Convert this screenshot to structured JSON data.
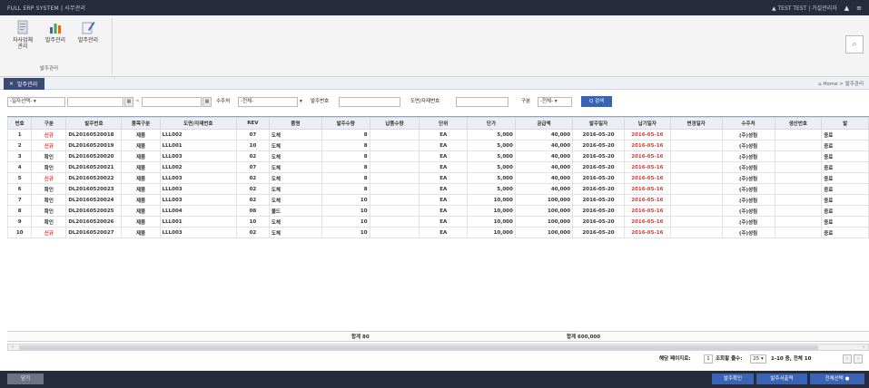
{
  "topbar": {
    "app_title": "FULL ERP SYSTEM  |  사무관리",
    "user": "▲ TEST TEST | 가설관리자",
    "home_icon": "▲",
    "menu_icon": "≡"
  },
  "ribbon": {
    "buttons": [
      {
        "label": "자사업체\n관리",
        "icon": "document-icon"
      },
      {
        "label": "발주관리",
        "icon": "chart-icon"
      },
      {
        "label": "발주관리",
        "icon": "edit-icon"
      }
    ],
    "group_label": "발주관리"
  },
  "section": {
    "tab_label": "발주관리",
    "breadcrumb": "⌂ Home  >  발주관리"
  },
  "filters": {
    "date_type": "-일자선택- ▾",
    "customer_label": "수주처",
    "customer_value": "-전체-",
    "order_no_label": "발주번호",
    "drawing_label": "도면/자재번호",
    "type_label": "구분",
    "type_value": "-전체- ▾",
    "search_button": "Q 검색"
  },
  "table": {
    "headers": [
      "번호",
      "구분",
      "발주번호",
      "품목구분",
      "도면/자재번호",
      "REV",
      "품명",
      "발주수량",
      "납품수량",
      "단위",
      "단가",
      "공급액",
      "발주일자",
      "납기일자",
      "변경일자",
      "수주처",
      "생산번호",
      "발"
    ],
    "rows": [
      [
        "1",
        "신규",
        "DL20160520018",
        "제품",
        "LLL002",
        "07",
        "도체",
        "8",
        "",
        "EA",
        "5,000",
        "40,000",
        "2016-05-20",
        "2016-05-16",
        "",
        "(주)성림",
        "",
        "종료"
      ],
      [
        "2",
        "신규",
        "DL20160520019",
        "제품",
        "LLL001",
        "10",
        "도체",
        "8",
        "",
        "EA",
        "5,000",
        "40,000",
        "2016-05-20",
        "2016-05-16",
        "",
        "(주)성림",
        "",
        "종료"
      ],
      [
        "3",
        "확인",
        "DL20160520020",
        "제품",
        "LLL003",
        "02",
        "도체",
        "8",
        "",
        "EA",
        "5,000",
        "40,000",
        "2016-05-20",
        "2016-05-16",
        "",
        "(주)성림",
        "",
        "종료"
      ],
      [
        "4",
        "확인",
        "DL20160520021",
        "제품",
        "LLL002",
        "07",
        "도체",
        "8",
        "",
        "EA",
        "5,000",
        "40,000",
        "2016-05-20",
        "2016-05-16",
        "",
        "(주)성림",
        "",
        "종료"
      ],
      [
        "5",
        "신규",
        "DL20160520022",
        "제품",
        "LLL003",
        "02",
        "도체",
        "8",
        "",
        "EA",
        "5,000",
        "40,000",
        "2016-05-20",
        "2016-05-16",
        "",
        "(주)성림",
        "",
        "종료"
      ],
      [
        "6",
        "확인",
        "DL20160520023",
        "제품",
        "LLL003",
        "02",
        "도체",
        "8",
        "",
        "EA",
        "5,000",
        "40,000",
        "2016-05-20",
        "2016-05-16",
        "",
        "(주)성림",
        "",
        "종료"
      ],
      [
        "7",
        "확인",
        "DL20160520024",
        "제품",
        "LLL003",
        "02",
        "도체",
        "10",
        "",
        "EA",
        "10,000",
        "100,000",
        "2016-05-20",
        "2016-05-16",
        "",
        "(주)성림",
        "",
        "종료"
      ],
      [
        "8",
        "확인",
        "DL20160520025",
        "제품",
        "LLL004",
        "08",
        "몰드",
        "10",
        "",
        "EA",
        "10,000",
        "100,000",
        "2016-05-20",
        "2016-05-16",
        "",
        "(주)성림",
        "",
        "종료"
      ],
      [
        "9",
        "확인",
        "DL20160520026",
        "제품",
        "LLL001",
        "10",
        "도체",
        "10",
        "",
        "EA",
        "10,000",
        "100,000",
        "2016-05-20",
        "2016-05-16",
        "",
        "(주)성림",
        "",
        "종료"
      ],
      [
        "10",
        "신규",
        "DL20160520027",
        "제품",
        "LLL003",
        "02",
        "도체",
        "10",
        "",
        "EA",
        "10,000",
        "100,000",
        "2016-05-20",
        "2016-05-16",
        "",
        "(주)성림",
        "",
        "종료"
      ]
    ]
  },
  "summary": {
    "qty_total": "합계 80",
    "amount_total": "합계 600,000"
  },
  "pager": {
    "page_label": "해당 페이지로:",
    "page_value": "1",
    "rows_label": "조회할 줄수:",
    "rows_value": "25 ▾",
    "range_text": "1-10 중, 전체 10",
    "prev": "‹",
    "next": "›"
  },
  "bottom": {
    "close_button": "닫기",
    "btn_confirm": "발주확인",
    "btn_print": "발주서출력",
    "btn_select_all": "전체선택 ●"
  },
  "colors": {
    "topbar": "#262b3d",
    "accent": "#3b63b4",
    "alert": "#e0342f"
  }
}
